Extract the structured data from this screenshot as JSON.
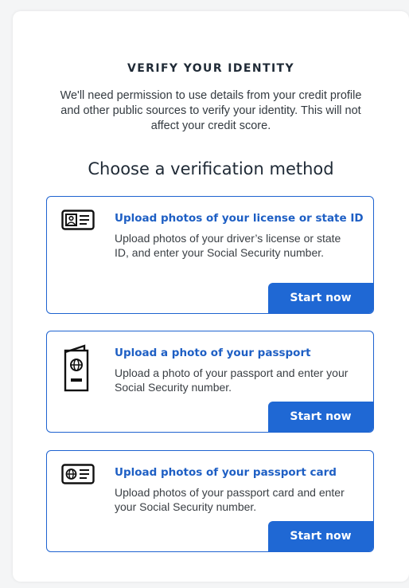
{
  "page": {
    "heading": "VERIFY YOUR IDENTITY",
    "intro": "We'll need permission to use details from your credit profile and other public sources to verify your identity. This will not affect your credit score.",
    "subheading": "Choose a verification method"
  },
  "methods": [
    {
      "icon": "id-card-icon",
      "title": "Upload photos of your license or state ID",
      "description": "Upload photos of your driver’s license or state ID, and enter your Social Security number.",
      "button": "Start now"
    },
    {
      "icon": "passport-icon",
      "title": "Upload a photo of your passport",
      "description": "Upload a photo of your passport and enter your Social Security number.",
      "button": "Start now"
    },
    {
      "icon": "passport-card-icon",
      "title": "Upload photos of your passport card",
      "description": "Upload photos of your passport card and enter your Social Security number.",
      "button": "Start now"
    }
  ],
  "colors": {
    "accent": "#1f68d4",
    "link": "#1e5fc4",
    "text": "#1f2a36"
  }
}
